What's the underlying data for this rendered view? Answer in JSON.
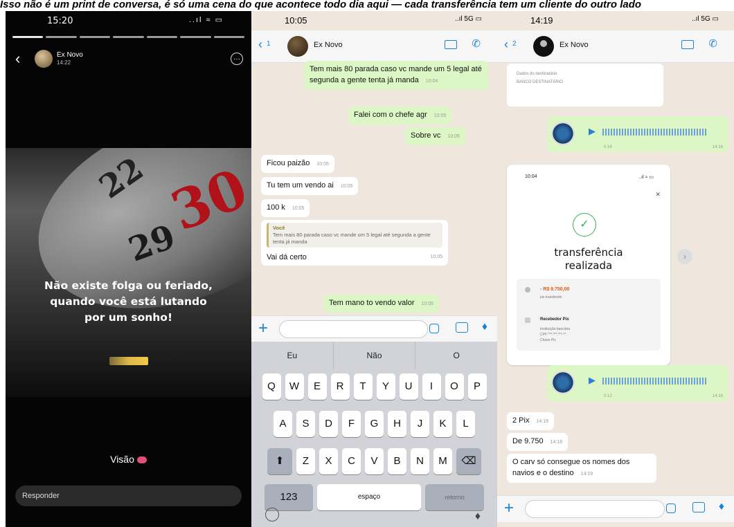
{
  "caption": "Isso não é um print de conversa, é só uma cena do que acontece todo dia aqui — cada transferência tem um cliente do outro lado",
  "story": {
    "time": "15:20",
    "status_icons": "..ıl ≈ ▭",
    "username": "Ex Novo",
    "ago": "14:22",
    "quote_lines": [
      "Não existe folga ou feriado,",
      "quando você está lutando",
      "por um sonho!"
    ],
    "calendar_numbers": [
      "22",
      "29",
      "30"
    ],
    "seen_label": "Visão",
    "reply_placeholder": "Responder"
  },
  "chat1": {
    "time": "10:05",
    "signal": "..ıl 5G ▭",
    "back_count": "1",
    "contact": "Ex Novo",
    "messages": [
      {
        "dir": "out",
        "text": "Tem mais 80 parada caso vc mande um 5 legal até segunda a gente tenta já manda",
        "time": "10:04"
      },
      {
        "dir": "out",
        "text": "Falei com o chefe agr",
        "time": "10:05"
      },
      {
        "dir": "out",
        "text": "Sobre vc",
        "time": "10:05"
      },
      {
        "dir": "in",
        "text": "Ficou paizão",
        "time": "10:05"
      },
      {
        "dir": "in",
        "text": "Tu tem um vendo ai",
        "time": "10:05"
      },
      {
        "dir": "in",
        "text": "100 k",
        "time": "10:05"
      },
      {
        "dir": "in",
        "quote_author": "Você",
        "quote_text": "Tem mais 80 parada caso vc mande um 5 legal até segunda a gente tenta já manda",
        "text": "Vai dá certo",
        "time": "10:05"
      },
      {
        "dir": "out",
        "text": "Tem mano to vendo valor",
        "time": "10:05"
      }
    ],
    "suggestions": [
      "Eu",
      "Não",
      "O"
    ],
    "keyboard_rows": [
      [
        "Q",
        "W",
        "E",
        "R",
        "T",
        "Y",
        "U",
        "I",
        "O",
        "P"
      ],
      [
        "A",
        "S",
        "D",
        "F",
        "G",
        "H",
        "J",
        "K",
        "L"
      ],
      [
        "Z",
        "X",
        "C",
        "V",
        "B",
        "N",
        "M"
      ]
    ],
    "key_123": "123",
    "key_space": "espaço",
    "key_return": "retorno"
  },
  "chat2": {
    "time": "14:19",
    "signal": "..ıl 5G ▭",
    "back_count": "2",
    "contact": "Ex Novo",
    "doc_lines": [
      "Dados do destinatário",
      "BANCO DESTINATÁRIO"
    ],
    "voice1_time": "14:16",
    "voice1_dur": "0:16",
    "receipt": {
      "time": "10:04",
      "signal": "..ıl ≈ ▭",
      "title_1": "transferência",
      "title_2": "realizada",
      "amount": "- R$ 9.750,00",
      "amount_label": "pix transferido",
      "recipient": "Recebedor Pix",
      "recipient_details": [
        "Instituição bancária",
        "CPF ***.***.***-**",
        "Chave Pix"
      ]
    },
    "voice2_time": "14:18",
    "voice2_dur": "0:12",
    "messages": [
      {
        "dir": "in",
        "text": "2 Pix",
        "time": "14:18"
      },
      {
        "dir": "in",
        "text": "De 9.750",
        "time": "14:18"
      },
      {
        "dir": "in",
        "text": "O carv só consegue os nomes dos navios e o destino",
        "time": "14:19"
      }
    ]
  }
}
